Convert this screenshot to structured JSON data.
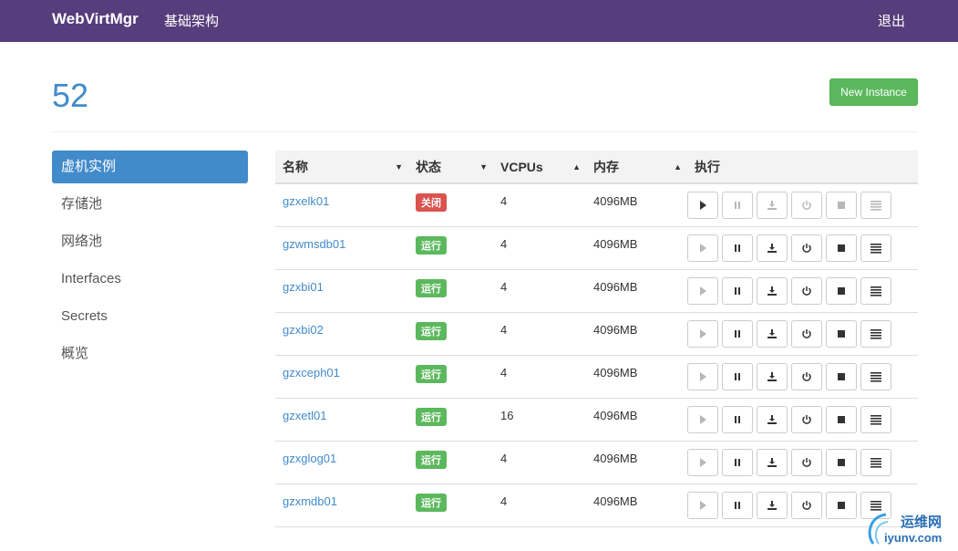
{
  "navbar": {
    "brand": "WebVirtMgr",
    "link": "基础架构",
    "logout": "退出",
    "bg_color": "#563d7c"
  },
  "header": {
    "title": "52",
    "new_instance_label": "New Instance"
  },
  "sidebar": {
    "items": [
      {
        "label": "虚机实例",
        "active": true
      },
      {
        "label": "存储池",
        "active": false
      },
      {
        "label": "网络池",
        "active": false
      },
      {
        "label": "Interfaces",
        "active": false
      },
      {
        "label": "Secrets",
        "active": false
      },
      {
        "label": "概览",
        "active": false
      }
    ]
  },
  "table": {
    "headers": [
      "名称",
      "状态",
      "VCPUs",
      "内存",
      "执行"
    ],
    "rows": [
      {
        "name": "gzxelk01",
        "status": "关闭",
        "running": false,
        "vcpus": "4",
        "memory": "4096MB"
      },
      {
        "name": "gzwmsdb01",
        "status": "运行",
        "running": true,
        "vcpus": "4",
        "memory": "4096MB"
      },
      {
        "name": "gzxbi01",
        "status": "运行",
        "running": true,
        "vcpus": "4",
        "memory": "4096MB"
      },
      {
        "name": "gzxbi02",
        "status": "运行",
        "running": true,
        "vcpus": "4",
        "memory": "4096MB"
      },
      {
        "name": "gzxceph01",
        "status": "运行",
        "running": true,
        "vcpus": "4",
        "memory": "4096MB"
      },
      {
        "name": "gzxetl01",
        "status": "运行",
        "running": true,
        "vcpus": "16",
        "memory": "4096MB"
      },
      {
        "name": "gzxglog01",
        "status": "运行",
        "running": true,
        "vcpus": "4",
        "memory": "4096MB"
      },
      {
        "name": "gzxmdb01",
        "status": "运行",
        "running": true,
        "vcpus": "4",
        "memory": "4096MB"
      }
    ],
    "action_icons": [
      "play-icon",
      "pause-icon",
      "download-icon",
      "power-icon",
      "stop-icon",
      "menu-icon"
    ]
  },
  "watermark": {
    "line1": "运维网",
    "line2": "iyunv.com"
  },
  "colors": {
    "primary": "#428bca",
    "success": "#5cb85c",
    "danger": "#d9534f"
  }
}
